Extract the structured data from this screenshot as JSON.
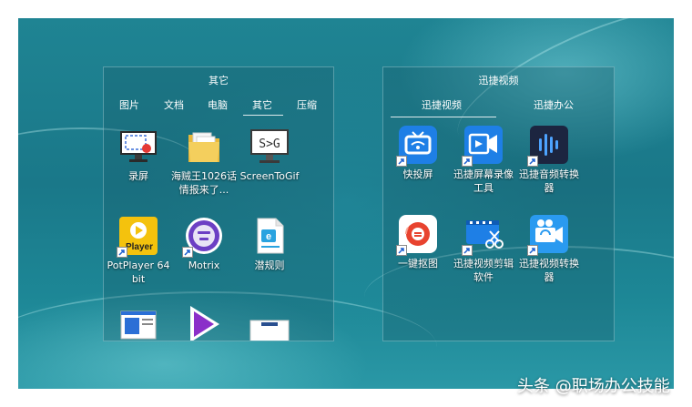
{
  "left_fence": {
    "title": "其它",
    "tabs": [
      "图片",
      "文档",
      "电脑",
      "其它",
      "压缩"
    ],
    "active_tab": "其它",
    "items": [
      {
        "label": "录屏",
        "icon": "screen-recorder-icon"
      },
      {
        "label": "海贼王1026话情报来了...",
        "icon": "folder-icon"
      },
      {
        "label": "ScreenToGif",
        "icon": "screentogif-icon"
      },
      {
        "label": "PotPlayer 64 bit",
        "icon": "potplayer-icon"
      },
      {
        "label": "Motrix",
        "icon": "motrix-icon"
      },
      {
        "label": "潜规则",
        "icon": "document-icon"
      }
    ]
  },
  "right_fence": {
    "title": "迅捷视频",
    "tabs": [
      "迅捷视频",
      "迅捷办公"
    ],
    "active_tab": "迅捷视频",
    "items": [
      {
        "label": "快投屏",
        "icon": "cast-screen-icon"
      },
      {
        "label": "迅捷屏幕录像工具",
        "icon": "screen-record-tool-icon"
      },
      {
        "label": "迅捷音频转换器",
        "icon": "audio-converter-icon"
      },
      {
        "label": "一键抠图",
        "icon": "cutout-icon"
      },
      {
        "label": "迅捷视频剪辑软件",
        "icon": "video-editor-icon"
      },
      {
        "label": "迅捷视频转换器",
        "icon": "video-converter-icon"
      }
    ]
  },
  "watermark": "头条 @职场办公技能",
  "colors": {
    "desktop_teal": "#1a7889",
    "potplayer_yellow": "#f4c20d",
    "blue_icon": "#1e7fe6",
    "dark_navy": "#1c2540",
    "cutout_red": "#e8432f"
  }
}
